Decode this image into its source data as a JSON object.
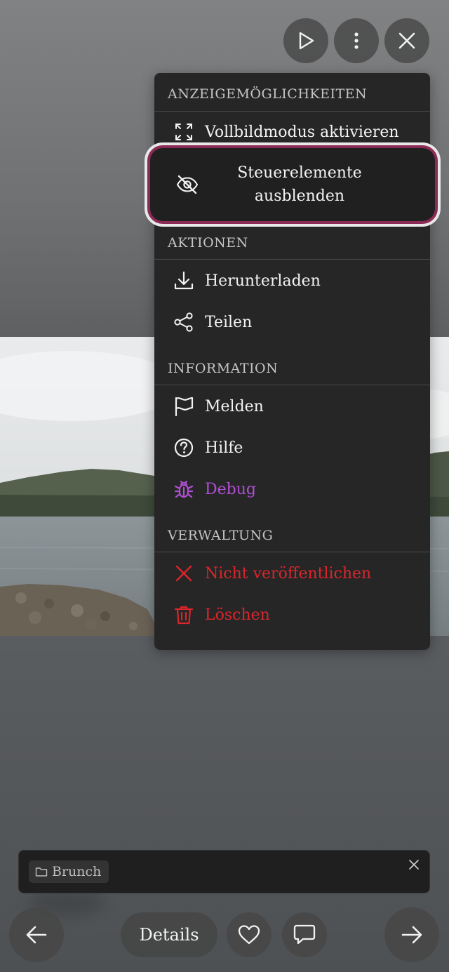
{
  "menu": {
    "display_section": "ANZEIGEMÖGLICHKEITEN",
    "fullscreen": "Vollbildmodus aktivieren",
    "hide_controls": "Steuerelemente ausblenden",
    "actions_section": "AKTIONEN",
    "download": "Herunterladen",
    "share": "Teilen",
    "info_section": "INFORMATION",
    "report": "Melden",
    "help": "Hilfe",
    "debug": "Debug",
    "admin_section": "VERWALTUNG",
    "unpublish": "Nicht veröffentlichen",
    "delete": "Löschen"
  },
  "album": {
    "name": "Brunch"
  },
  "bottom_nav": {
    "details": "Details"
  },
  "colors": {
    "menu_bg": "#262626",
    "highlight_ring": "#8a2a55",
    "debug_purple": "#b04fd4",
    "danger_red": "#d9262c"
  },
  "icons": {
    "play": "play-icon",
    "more": "more-vertical-icon",
    "close": "close-icon",
    "fullscreen": "fullscreen-icon",
    "eye_off": "eye-off-icon",
    "download": "download-icon",
    "share": "share-icon",
    "flag": "flag-icon",
    "help": "help-circle-icon",
    "bug": "bug-icon",
    "x": "x-icon",
    "trash": "trash-icon",
    "folder": "folder-icon",
    "arrow_left": "arrow-left-icon",
    "heart": "heart-icon",
    "comment": "comment-icon",
    "arrow_right": "arrow-right-icon"
  }
}
